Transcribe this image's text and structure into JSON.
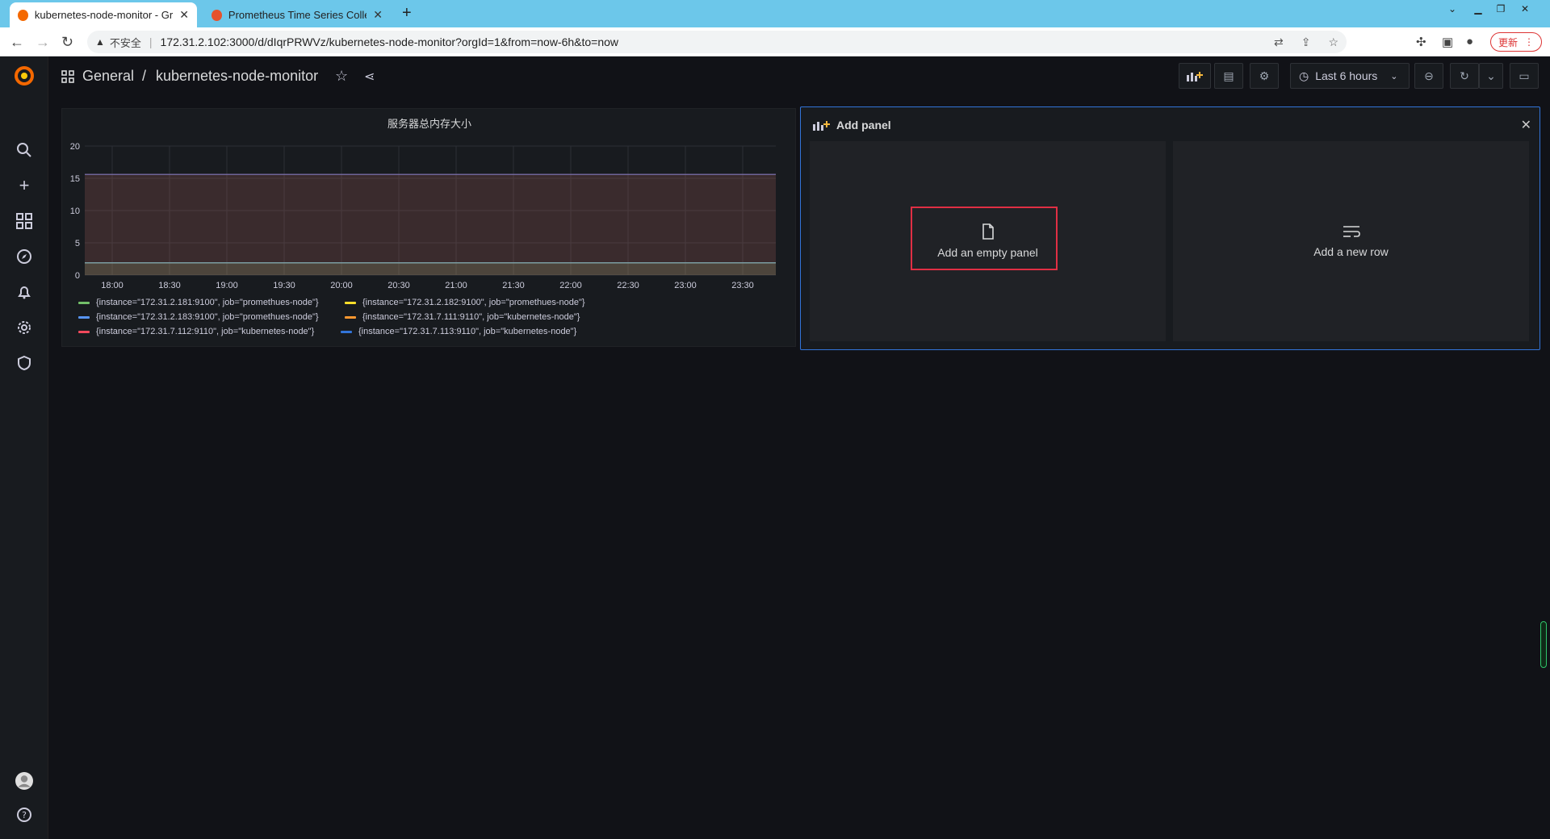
{
  "browser": {
    "tabs": [
      {
        "title": "kubernetes-node-monitor - Grafana",
        "active": true
      },
      {
        "title": "Prometheus Time Series Collection",
        "active": false
      }
    ],
    "new_tab": "+",
    "address": {
      "warning": "不安全",
      "url": "172.31.2.102:3000/d/dIqrPRWVz/kubernetes-node-monitor?orgId=1&from=now-6h&to=now"
    },
    "update_label": "更新"
  },
  "grafana": {
    "breadcrumb": {
      "folder": "General",
      "separator": "/",
      "dashboard": "kubernetes-node-monitor"
    },
    "time_picker": "Last 6 hours",
    "panel": {
      "title": "服务器总内存大小",
      "legend": [
        {
          "label": "{instance=\"172.31.2.181:9100\", job=\"promethues-node\"}",
          "color": "#73bf69"
        },
        {
          "label": "{instance=\"172.31.2.182:9100\", job=\"promethues-node\"}",
          "color": "#fade2a"
        },
        {
          "label": "{instance=\"172.31.2.183:9100\", job=\"promethues-node\"}",
          "color": "#5794f2"
        },
        {
          "label": "{instance=\"172.31.7.111:9110\", job=\"kubernetes-node\"}",
          "color": "#ff9830"
        },
        {
          "label": "{instance=\"172.31.7.112:9110\", job=\"kubernetes-node\"}",
          "color": "#f2495c"
        },
        {
          "label": "{instance=\"172.31.7.113:9110\", job=\"kubernetes-node\"}",
          "color": "#3274d9"
        }
      ]
    },
    "add_panel": {
      "header": "Add panel",
      "empty_panel": "Add an empty panel",
      "new_row": "Add a new row"
    }
  },
  "chart_data": {
    "type": "area",
    "title": "服务器总内存大小",
    "x": [
      "18:00",
      "18:30",
      "19:00",
      "19:30",
      "20:00",
      "20:30",
      "21:00",
      "21:30",
      "22:00",
      "22:30",
      "23:00",
      "23:30"
    ],
    "ylim": [
      0,
      20
    ],
    "yticks": [
      0,
      5,
      10,
      15,
      20
    ],
    "series": [
      {
        "name": "{instance=\"172.31.2.181:9100\", job=\"promethues-node\"}",
        "value": 1.9
      },
      {
        "name": "{instance=\"172.31.2.182:9100\", job=\"promethues-node\"}",
        "value": 1.9
      },
      {
        "name": "{instance=\"172.31.2.183:9100\", job=\"promethues-node\"}",
        "value": 1.9
      },
      {
        "name": "{instance=\"172.31.7.111:9110\", job=\"kubernetes-node\"}",
        "value": 15.6
      },
      {
        "name": "{instance=\"172.31.7.112:9110\", job=\"kubernetes-node\"}",
        "value": 15.6
      },
      {
        "name": "{instance=\"172.31.7.113:9110\", job=\"kubernetes-node\"}",
        "value": 15.6
      }
    ],
    "grid": true,
    "legend": "bottom"
  }
}
